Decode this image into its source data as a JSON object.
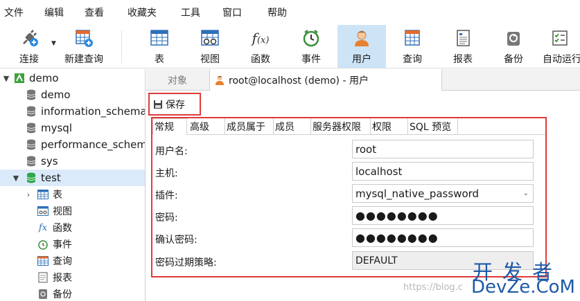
{
  "menubar": {
    "items": [
      "文件",
      "编辑",
      "查看",
      "收藏夹",
      "工具",
      "窗口",
      "帮助"
    ]
  },
  "toolbar": {
    "buttons": [
      {
        "label": "连接",
        "icon": "connect-plug-icon"
      },
      {
        "label": "新建查询",
        "icon": "new-query-icon"
      },
      {
        "label": "表",
        "icon": "table-icon"
      },
      {
        "label": "视图",
        "icon": "view-icon"
      },
      {
        "label": "函数",
        "icon": "function-icon"
      },
      {
        "label": "事件",
        "icon": "event-clock-icon"
      },
      {
        "label": "用户",
        "icon": "user-icon"
      },
      {
        "label": "查询",
        "icon": "query-icon"
      },
      {
        "label": "报表",
        "icon": "report-icon"
      },
      {
        "label": "备份",
        "icon": "backup-icon"
      },
      {
        "label": "自动运行",
        "icon": "auto-run-icon"
      }
    ],
    "active": "用户"
  },
  "sidebar": {
    "connection": "demo",
    "databases": [
      "demo",
      "information_schema",
      "mysql",
      "performance_schema",
      "sys",
      "test"
    ],
    "selected": "test",
    "children": [
      "表",
      "视图",
      "函数",
      "事件",
      "查询",
      "报表",
      "备份"
    ]
  },
  "tabs": {
    "objects": "对象",
    "active": "root@localhost (demo) - 用户"
  },
  "editor": {
    "save_label": "保存",
    "subtabs": [
      "常规",
      "高级",
      "成员属于",
      "成员",
      "服务器权限",
      "权限",
      "SQL 预览"
    ],
    "fields": [
      {
        "label": "用户名:",
        "value": "root"
      },
      {
        "label": "主机:",
        "value": "localhost"
      },
      {
        "label": "插件:",
        "value": "mysql_native_password"
      },
      {
        "label": "密码:",
        "value": "●●●●●●●●"
      },
      {
        "label": "确认密码:",
        "value": "●●●●●●●●"
      },
      {
        "label": "密码过期策略:",
        "value": "DEFAULT"
      }
    ]
  },
  "watermark": {
    "text": "https://blog.c",
    "brand_cn": "开发者",
    "brand_en": "DevZe.CoM"
  },
  "colors": {
    "highlight_red": "#e03a3a",
    "active_tab_blue": "#cde4f7",
    "selected_row": "#dbeafa",
    "brand_blue": "#1e5aa6"
  }
}
